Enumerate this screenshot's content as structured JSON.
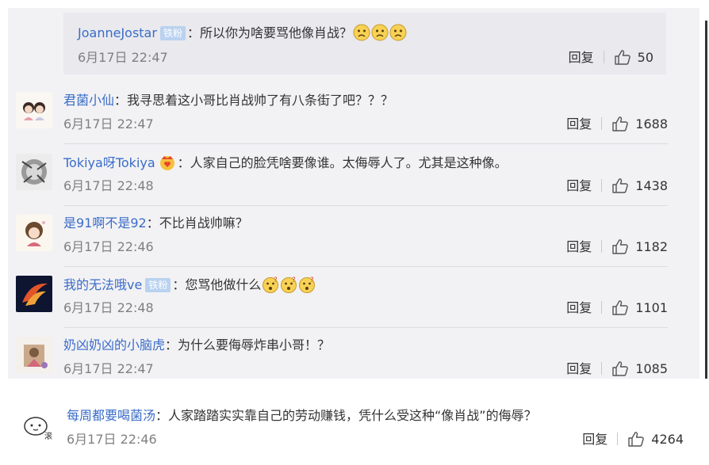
{
  "nested_reply": {
    "user": "JoanneJostar",
    "badge": "铁粉",
    "text": "：所以你为啥要骂他像肖战？",
    "emojis": [
      "sad-face-emoji",
      "sad-face-emoji",
      "sad-face-emoji"
    ],
    "time": "6月17日 22:47",
    "reply_label": "回复",
    "likes": "50"
  },
  "comments": [
    {
      "user": "君菌小仙",
      "badge": "",
      "text": "：我寻思着这小哥比肖战帅了有八条街了吧？？？",
      "time": "6月17日 22:47",
      "reply_label": "回复",
      "likes": "1688"
    },
    {
      "user": "Tokiya呀Tokiya",
      "badge": "",
      "text": "：人家自己的脸凭啥要像谁。太侮辱人了。尤其是这种像。",
      "time": "6月17日 22:48",
      "reply_label": "回复",
      "likes": "1438"
    },
    {
      "user": "是91啊不是92",
      "badge": "",
      "text": "：不比肖战帅嘛？",
      "time": "6月17日 22:46",
      "reply_label": "回复",
      "likes": "1182"
    },
    {
      "user": "我的无法哦ve",
      "badge": "铁粉",
      "text": "：您骂他做什么",
      "time": "6月17日 22:48",
      "reply_label": "回复",
      "likes": "1101"
    },
    {
      "user": "奶凶奶凶的小脑虎",
      "badge": "",
      "text": "：为什么要侮辱炸串小哥！？",
      "time": "6月17日 22:47",
      "reply_label": "回复",
      "likes": "1085"
    },
    {
      "user": "每周都要喝菌汤",
      "badge": "",
      "text": "：人家踏踏实实靠自己的劳动赚钱，凭什么受这种“像肖战”的侮辱？",
      "time": "6月17日 22:46",
      "reply_label": "回复",
      "likes": "4264"
    }
  ],
  "colors": {
    "username": "#3a6cc7",
    "panel_bg": "#f2f2f5",
    "reply_box_bg": "#e9e9ee",
    "badge_bg": "#bad2f0"
  }
}
